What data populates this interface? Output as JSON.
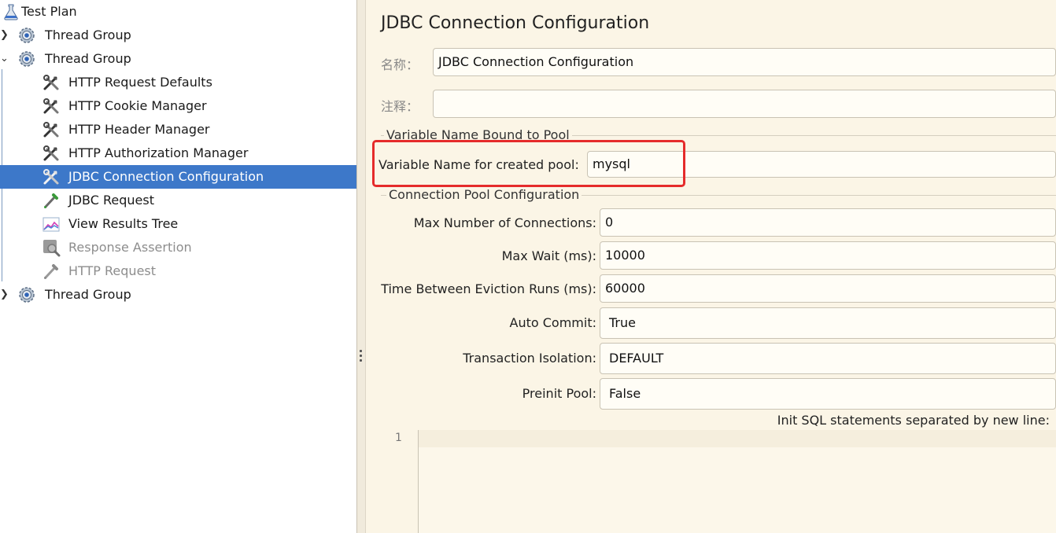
{
  "tree": {
    "items": [
      {
        "label": "Test Plan",
        "icon": "flask-icon"
      },
      {
        "label": "Thread Group",
        "icon": "gear-icon",
        "expanded": false
      },
      {
        "label": "Thread Group",
        "icon": "gear-icon",
        "expanded": true
      },
      {
        "label": "HTTP Request Defaults",
        "icon": "wrench-screwdriver-icon"
      },
      {
        "label": "HTTP Cookie Manager",
        "icon": "wrench-screwdriver-icon"
      },
      {
        "label": "HTTP Header Manager",
        "icon": "wrench-screwdriver-icon"
      },
      {
        "label": "HTTP Authorization Manager",
        "icon": "wrench-screwdriver-icon"
      },
      {
        "label": "JDBC Connection Configuration",
        "icon": "wrench-screwdriver-icon",
        "selected": true
      },
      {
        "label": "JDBC Request",
        "icon": "pipette-icon"
      },
      {
        "label": "View Results Tree",
        "icon": "chart-icon"
      },
      {
        "label": "Response Assertion",
        "icon": "magnifier-icon",
        "disabled": true
      },
      {
        "label": "HTTP Request",
        "icon": "pipette-icon",
        "disabled": true
      },
      {
        "label": "Thread Group",
        "icon": "gear-icon",
        "expanded": false
      }
    ]
  },
  "panel": {
    "title": "JDBC Connection Configuration",
    "name_label": "名称：",
    "name_value": "JDBC Connection Configuration",
    "comment_label": "注释：",
    "comment_value": "",
    "section_pool_var": "Variable Name Bound to Pool",
    "pool_var_label": "Variable Name for created pool:",
    "pool_var_value": "mysql",
    "section_conn_pool": "Connection Pool Configuration",
    "max_conn_label": "Max Number of Connections:",
    "max_conn_value": "0",
    "max_wait_label": "Max Wait (ms):",
    "max_wait_value": "10000",
    "eviction_label": "Time Between Eviction Runs (ms):",
    "eviction_value": "60000",
    "auto_commit_label": "Auto Commit:",
    "auto_commit_value": "True",
    "tx_iso_label": "Transaction Isolation:",
    "tx_iso_value": "DEFAULT",
    "preinit_label": "Preinit Pool:",
    "preinit_value": "False",
    "init_sql_label": "Init SQL statements separated by new line:",
    "line_number": "1"
  },
  "colors": {
    "selection": "#3d78c9",
    "highlight_box": "#e52b2b",
    "panel_bg": "#fbf5e6"
  }
}
